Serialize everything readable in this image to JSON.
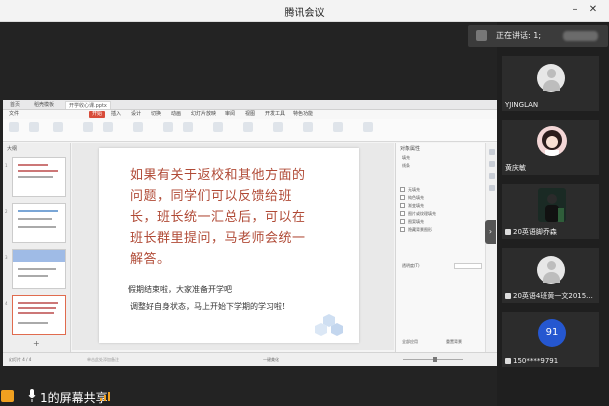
{
  "window": {
    "title": "腾讯会议"
  },
  "wps": {
    "tabs": [
      "首页",
      "稻壳模板",
      "开学收心课.pptx"
    ],
    "menu": [
      "文件",
      "开始",
      "插入",
      "设计",
      "切换",
      "动画",
      "幻灯片放映",
      "审阅",
      "视图",
      "开发工具",
      "特色功能"
    ],
    "thumb_header": "大纲",
    "thumb_numbers": [
      "1",
      "2",
      "3",
      "4"
    ],
    "panel_title": "对象属性",
    "panel_rows": [
      "填充",
      "线条",
      "无填充",
      "纯色填充",
      "渐变填充",
      "图片或纹理填充",
      "图案填充",
      "隐藏背景图形",
      "透明度(T)",
      "全部应用",
      "重置背景"
    ],
    "status_left": "幻灯片 4 / 4",
    "status_notes": "单击此处添加备注",
    "status_zoom": "一键美化"
  },
  "slide": {
    "body_text": "如果有关于返校和其他方面的问题，同学们可以反馈给班长，班长统一汇总后，可以在班长群里提问，马老师会统一解答。",
    "line1": "假期结束啦，大家准备开学吧",
    "line2": "调整好自身状态，马上开始下学期的学习啦!"
  },
  "share_bar": {
    "label": "1的屏幕共享"
  },
  "speaker": {
    "label": "正在讲话: 1;"
  },
  "participants": [
    {
      "name": "YJINGLAN",
      "avatar": "default"
    },
    {
      "name": "黄庆敏",
      "avatar": "photo"
    },
    {
      "name": "20英语脚乔森",
      "avatar": "dark"
    },
    {
      "name": "20英语4班黄一文2015...",
      "avatar": "default"
    },
    {
      "name": "150****9791",
      "avatar": "91"
    }
  ],
  "colors": {
    "accent": "#d84c3a",
    "slide_text": "#b04a36",
    "share_icon": "#f0a020",
    "badge_blue": "#2557d0"
  }
}
